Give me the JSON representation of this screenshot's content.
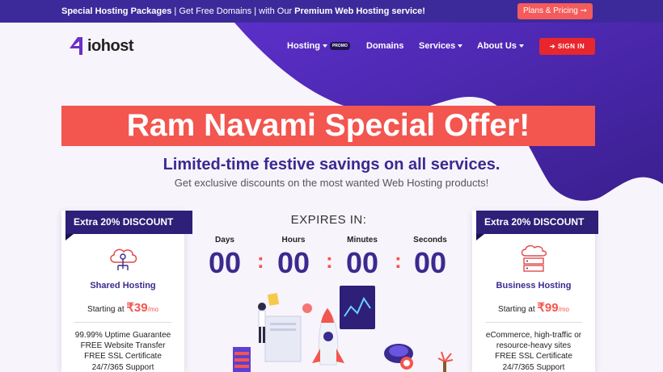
{
  "topbar": {
    "promo_bold": "Special Hosting Packages",
    "promo_mid": " | Get Free Domains | with Our ",
    "promo_end": "Premium Web Hosting service!",
    "plans_button": "Plans & Pricing ➞"
  },
  "header": {
    "logo_mark": "4",
    "logo_text": "iohost",
    "nav": [
      {
        "label": "Hosting",
        "badge": "PROMO"
      },
      {
        "label": "Domains"
      },
      {
        "label": "Services"
      },
      {
        "label": "About Us"
      }
    ],
    "signin": "SIGN IN"
  },
  "hero": {
    "banner": "Ram Navami Special Offer!",
    "headline": "Limited-time festive savings on all services.",
    "subline": "Get exclusive discounts on the most wanted Web Hosting products!"
  },
  "countdown": {
    "title": "EXPIRES IN:",
    "units": [
      {
        "label": "Days",
        "value": "00"
      },
      {
        "label": "Hours",
        "value": "00"
      },
      {
        "label": "Minutes",
        "value": "00"
      },
      {
        "label": "Seconds",
        "value": "00"
      }
    ],
    "separator": ":"
  },
  "cards": [
    {
      "ribbon": "Extra 20% DISCOUNT",
      "title": "Shared Hosting",
      "price_prefix": "Starting at ",
      "price": "₹39",
      "price_suffix": "/mo",
      "features": [
        "99.99% Uptime Guarantee",
        "FREE Website Transfer",
        "FREE SSL Certificate",
        "24/7/365 Support"
      ]
    },
    {
      "ribbon": "Extra 20% DISCOUNT",
      "title": "Business Hosting",
      "price_prefix": "Starting at ",
      "price": "₹99",
      "price_suffix": "/mo",
      "features": [
        "eCommerce, high-traffic or",
        "resource-heavy sites",
        "FREE SSL Certificate",
        "24/7/365 Support"
      ]
    }
  ],
  "colors": {
    "brand_purple": "#3d2a9a",
    "accent_red": "#f3554f",
    "signin_red": "#e8262e"
  }
}
